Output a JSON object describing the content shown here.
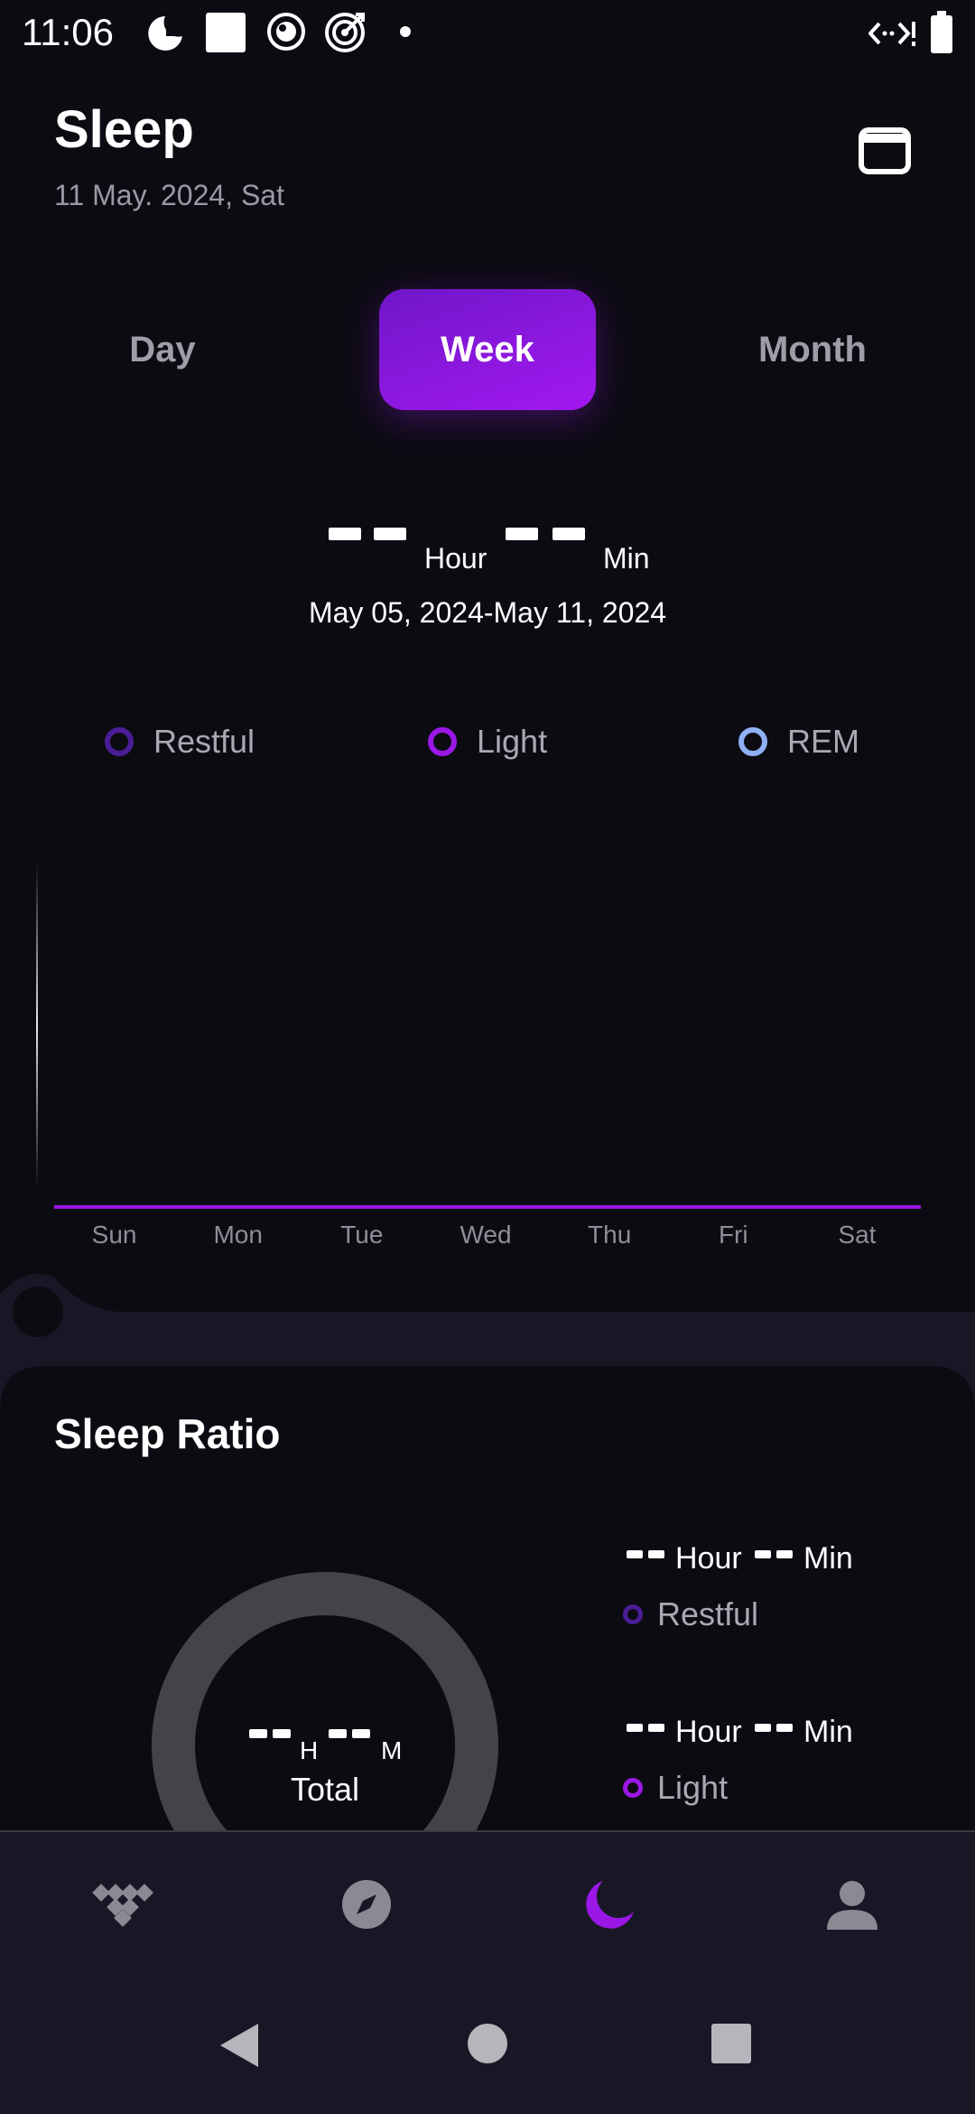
{
  "status_bar": {
    "time": "11:06",
    "icons": [
      "sleep-clock-icon",
      "white-square-icon",
      "camera-icon",
      "target-icon",
      "dot-icon",
      "network-icon",
      "battery-icon"
    ]
  },
  "header": {
    "title": "Sleep",
    "date": "11 May. 2024, Sat",
    "calendar_icon": "calendar-icon"
  },
  "tabs": [
    {
      "label": "Day",
      "active": false
    },
    {
      "label": "Week",
      "active": true
    },
    {
      "label": "Month",
      "active": false
    }
  ],
  "summary": {
    "hour_value": "-- --",
    "hour_unit": "Hour",
    "min_value": "-- --",
    "min_unit": "Min",
    "range": "May 05, 2024-May 11, 2024"
  },
  "legend": [
    {
      "label": "Restful",
      "color": "#4a1d96"
    },
    {
      "label": "Light",
      "color": "#9b17e6"
    },
    {
      "label": "REM",
      "color": "#8fb0f5"
    }
  ],
  "chart_data": {
    "type": "bar",
    "categories": [
      "Sun",
      "Mon",
      "Tue",
      "Wed",
      "Thu",
      "Fri",
      "Sat"
    ],
    "series": [
      {
        "name": "Restful",
        "values": [
          0,
          0,
          0,
          0,
          0,
          0,
          0
        ]
      },
      {
        "name": "Light",
        "values": [
          0,
          0,
          0,
          0,
          0,
          0,
          0
        ]
      },
      {
        "name": "REM",
        "values": [
          0,
          0,
          0,
          0,
          0,
          0,
          0
        ]
      }
    ],
    "title": "",
    "xlabel": "",
    "ylabel": "",
    "baseline_color": "#9b17e6",
    "grid": false,
    "legend_position": "top"
  },
  "ratio": {
    "title": "Sleep Ratio",
    "donut_h_unit": "H",
    "donut_m_unit": "M",
    "donut_total": "Total",
    "donut_color": "#444448",
    "items": [
      {
        "label": "Restful",
        "hour_unit": "Hour",
        "min_unit": "Min",
        "color": "#4a1d96"
      },
      {
        "label": "Light",
        "hour_unit": "Hour",
        "min_unit": "Min",
        "color": "#9b17e6"
      }
    ]
  },
  "bottom_nav": [
    {
      "name": "dashboard",
      "icon": "grid-diamond-icon",
      "active": false
    },
    {
      "name": "explore",
      "icon": "compass-icon",
      "active": false
    },
    {
      "name": "sleep",
      "icon": "moon-icon",
      "active": true
    },
    {
      "name": "profile",
      "icon": "person-icon",
      "active": false
    }
  ],
  "system_nav": [
    "back-icon",
    "home-icon",
    "recents-icon"
  ]
}
